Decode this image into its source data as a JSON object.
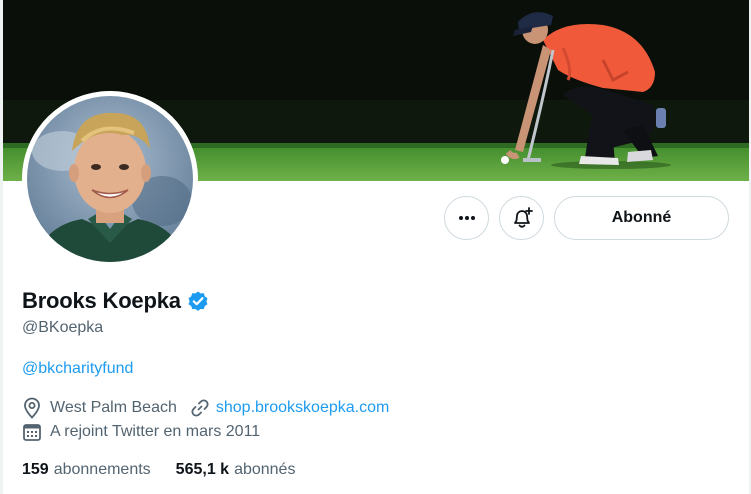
{
  "profile": {
    "display_name": "Brooks Koepka",
    "verified": true,
    "handle": "@BKoepka",
    "bio_mention": "@bkcharityfund",
    "location": "West Palm Beach",
    "website": "shop.brookskoepka.com",
    "joined": "A rejoint Twitter en mars 2011"
  },
  "actions": {
    "more_icon": "more-dots-icon",
    "bell_icon": "bell-plus-icon",
    "follow_label": "Abonné"
  },
  "stats": {
    "following_count": "159",
    "following_label": "abonnements",
    "followers_count": "565,1 k",
    "followers_label": "abonnés"
  },
  "colors": {
    "accent": "#1d9bf0",
    "text_primary": "#0f1419",
    "text_secondary": "#536471",
    "border": "#cfd9de"
  }
}
